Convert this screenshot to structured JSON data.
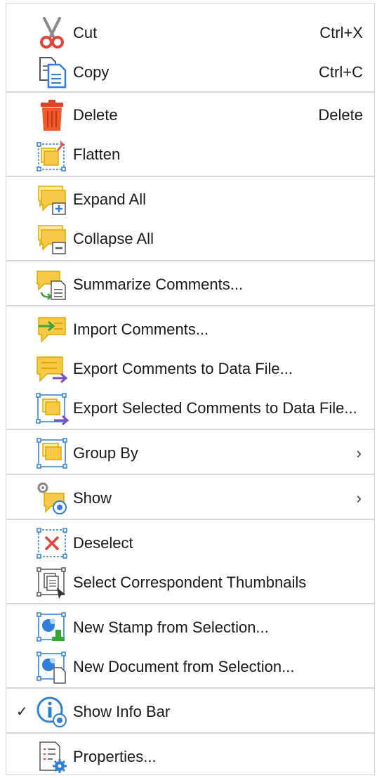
{
  "menu": {
    "items": [
      {
        "label": "Cut",
        "shortcut": "Ctrl+X",
        "icon": "scissors-icon"
      },
      {
        "label": "Copy",
        "shortcut": "Ctrl+C",
        "icon": "copy-icon"
      },
      {
        "label": "Delete",
        "shortcut": "Delete",
        "icon": "trash-icon"
      },
      {
        "label": "Flatten",
        "icon": "flatten-icon"
      },
      {
        "label": "Expand All",
        "icon": "expand-all-icon"
      },
      {
        "label": "Collapse All",
        "icon": "collapse-all-icon"
      },
      {
        "label": "Summarize Comments...",
        "icon": "summarize-icon"
      },
      {
        "label": "Import Comments...",
        "icon": "import-comments-icon"
      },
      {
        "label": "Export Comments to Data File...",
        "icon": "export-comments-icon"
      },
      {
        "label": "Export Selected Comments to Data File...",
        "icon": "export-selected-icon"
      },
      {
        "label": "Group By",
        "submenu_arrow": "›",
        "icon": "group-by-icon"
      },
      {
        "label": "Show",
        "submenu_arrow": "›",
        "icon": "show-icon"
      },
      {
        "label": "Deselect",
        "icon": "deselect-icon"
      },
      {
        "label": "Select Correspondent Thumbnails",
        "icon": "thumbnails-icon"
      },
      {
        "label": "New Stamp from Selection...",
        "icon": "new-stamp-icon"
      },
      {
        "label": "New Document from Selection...",
        "icon": "new-document-icon"
      },
      {
        "label": "Show Info Bar",
        "checked_mark": "✓",
        "icon": "info-bar-icon"
      },
      {
        "label": "Properties...",
        "icon": "properties-icon"
      }
    ]
  },
  "colors": {
    "comment_yellow": "#f7c948",
    "comment_yellow_light": "#fde9a0",
    "selection_blue": "#2f7fd8",
    "trash_red": "#f05a2b",
    "arrow_purple": "#7a4ec9",
    "arrow_green": "#3aa33a"
  }
}
